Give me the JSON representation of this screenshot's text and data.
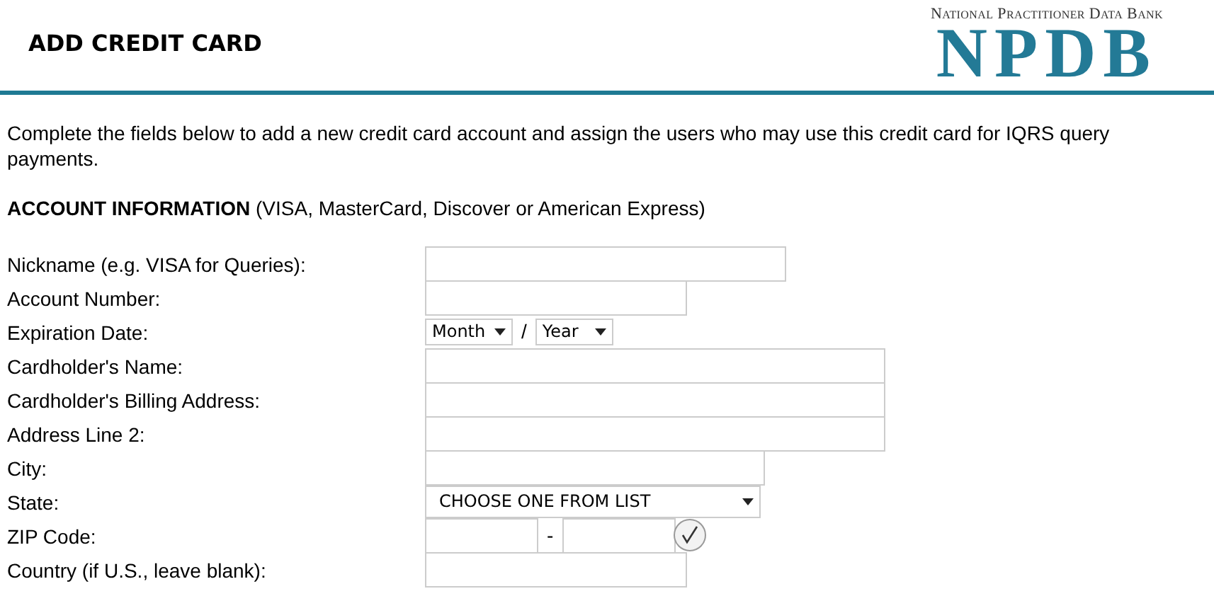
{
  "header": {
    "title": "ADD CREDIT CARD",
    "logo": {
      "tagline": "National Practitioner Data Bank",
      "mark": "NPDB"
    }
  },
  "intro": "Complete the fields below to add a new credit card account and assign the users who may use this credit card for IQRS query payments.",
  "section": {
    "heading": "ACCOUNT INFORMATION",
    "note": "(VISA, MasterCard, Discover or American Express)"
  },
  "fields": [
    {
      "label": "Nickname (e.g. VISA for Queries):",
      "kind": "text"
    },
    {
      "label": "Account Number:",
      "kind": "text"
    },
    {
      "label": "Expiration Date:",
      "kind": "date",
      "month": "Month",
      "separator": "/",
      "year": "Year"
    },
    {
      "label": "Cardholder's Name:",
      "kind": "text"
    },
    {
      "label": "Cardholder's Billing Address:",
      "kind": "text"
    },
    {
      "label": "Address Line 2:",
      "kind": "text"
    },
    {
      "label": "City:",
      "kind": "text"
    },
    {
      "label": "State:",
      "kind": "select",
      "value": "CHOOSE ONE FROM LIST"
    },
    {
      "label": "ZIP Code:",
      "kind": "zip",
      "separator": "-"
    },
    {
      "label": "Country (if U.S., leave blank):",
      "kind": "text"
    }
  ]
}
